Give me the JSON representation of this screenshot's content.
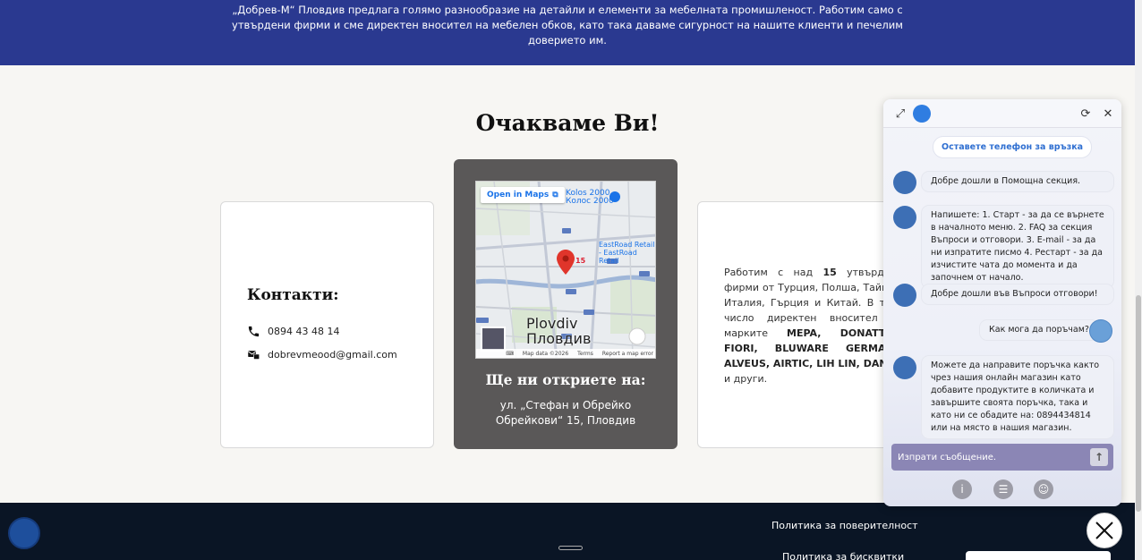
{
  "hero": {
    "text": "„Добрев-М“ Пловдив предлага голямо разнообразие на детайли и елементи за мебелната промишленост. Работим само с утвърдени фирми и сме директен вносител на мебелен обков, като така даваме сигурност на нашите клиенти и печелим доверието им."
  },
  "section": {
    "title": "Очакваме Ви!"
  },
  "contacts": {
    "title": "Контакти:",
    "phone": "0894 43 48 14",
    "email": "dobrevmeood@gmail.com",
    "phone_icon": "phone-icon",
    "email_icon": "email-icon"
  },
  "location": {
    "map": {
      "open_label": "Open in Maps",
      "city_latin": "Plovdiv",
      "city_cyrillic": "Пловдив",
      "poi_1_latin": "Kolos 2000",
      "poi_1_cyrillic": "Колос 2000",
      "poi_2_line_1": "EastRoad Retail",
      "poi_2_line_2": "- EastRoad Retail",
      "pin_number": "15",
      "footer_map_data": "Map data ©2026",
      "footer_terms": "Terms",
      "footer_report": "Report a map error"
    },
    "title": "Ще ни откриете на:",
    "address": "ул. „Стефан и Обрейко Обрейкови“ 15, Пловдив"
  },
  "about": {
    "text_1": "Работим с над ",
    "count": "15",
    "text_2": " утвърдени фирми от Турция, Полша, Тайван, Италия, Гърция и Китай. В това число директен вносител на марките ",
    "brands": "MEPA, DONATTES, FIORI, BLUWARE GERMANY, ALVEUS, AIRTIC, LIH LIN, DANCO",
    "text_3": " и други."
  },
  "footer": {
    "privacy_link": "Политика за поверителност",
    "cookies_link": "Политика за бисквитки"
  },
  "chat": {
    "suggestion": "Оставете телефон за връзка",
    "messages": [
      {
        "from": "bot",
        "text": "Добре дошли в Помощна секция."
      },
      {
        "from": "bot",
        "text": "Напишете: 1. Старт - за да се върнете в началното меню. 2. FAQ за секция Въпроси и отговори. 3. E-mail - за да ни изпратите писмо 4. Рестарт - за да изчистите чата до момента и да започнем от начало."
      },
      {
        "from": "bot",
        "text": "Добре дошли във Въпроси отговори!"
      },
      {
        "from": "user",
        "text": "Как мога да поръчам?"
      },
      {
        "from": "bot",
        "text": "Можете да направите поръчка както чрез нашия онлайн магазин като добавите продуктите в количката и завършите своята поръчка, така и като ни се обадите на: 0894434814 или на място в нашия магазин."
      }
    ],
    "input_placeholder": "Изпрати съобщение.",
    "colors": {
      "accent": "#2f7de1",
      "input_bg": "#8b86b5"
    }
  },
  "colors": {
    "hero_bg": "#2a3990",
    "footer_bg": "#0a1525",
    "location_card": "#5a5858"
  }
}
